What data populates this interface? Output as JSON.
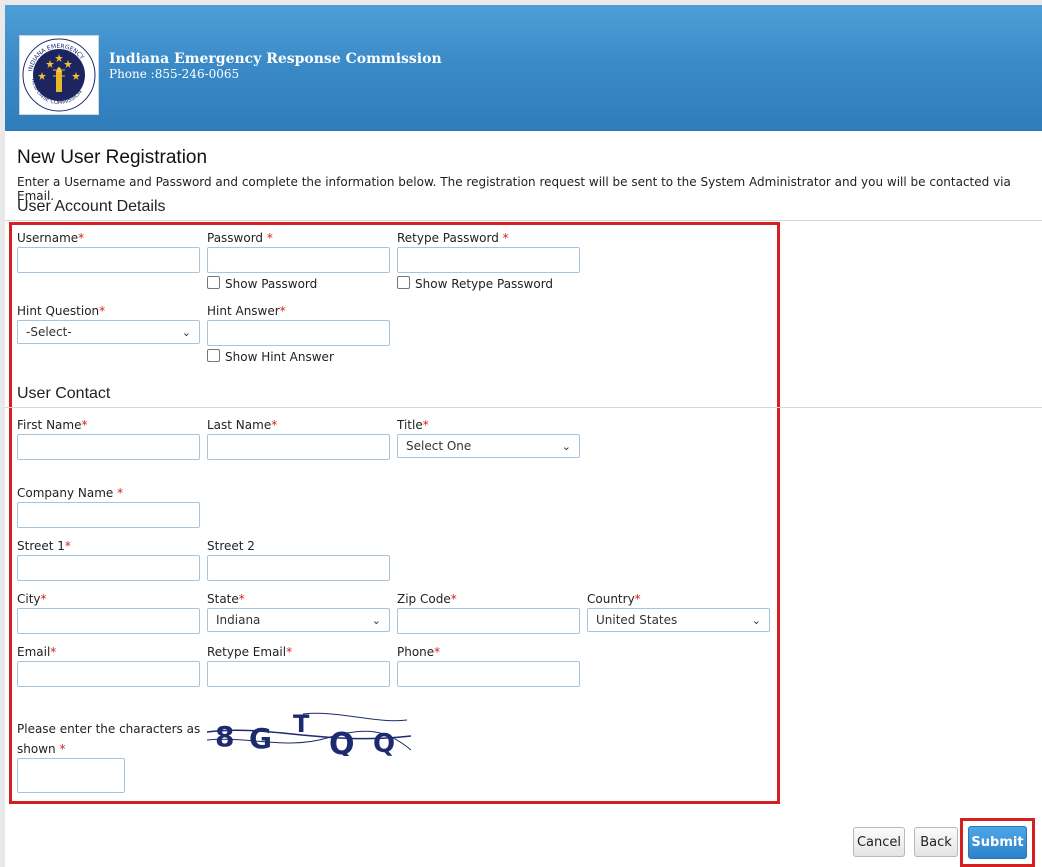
{
  "header": {
    "org_name": "Indiana Emergency Response Commission",
    "phone": "Phone :855-246-0065",
    "logo_text_top": "INDIANA EMERGENCY",
    "logo_text_bottom": "RESPONSE COMMISSION"
  },
  "page": {
    "title": "New User Registration",
    "instructions": "Enter a Username and Password and complete the information below. The registration request will be sent to the System Administrator and you will be contacted via Email."
  },
  "account": {
    "section_title": "User Account Details",
    "username_label": "Username",
    "password_label": "Password ",
    "retype_password_label": "Retype Password ",
    "show_password_label": "Show Password",
    "show_retype_password_label": "Show Retype Password",
    "hint_question_label": "Hint Question",
    "hint_question_value": "-Select-",
    "hint_answer_label": "Hint Answer",
    "show_hint_answer_label": "Show Hint Answer"
  },
  "contact": {
    "section_title": "User Contact",
    "first_name_label": "First Name",
    "last_name_label": "Last Name",
    "title_label": "Title",
    "title_value": "Select One",
    "company_label": "Company Name ",
    "street1_label": "Street 1",
    "street2_label": "Street 2",
    "city_label": "City",
    "state_label": "State",
    "state_value": "Indiana",
    "zip_label": "Zip Code",
    "country_label": "Country",
    "country_value": "United States",
    "email_label": "Email",
    "retype_email_label": "Retype Email",
    "phone_label": "Phone",
    "captcha_label_line1": "Please enter the characters as",
    "captcha_label_line2": "shown ",
    "captcha_text": "8 G T Q Q"
  },
  "required_marker": "*",
  "buttons": {
    "cancel": "Cancel",
    "back": "Back",
    "submit": "Submit"
  },
  "colors": {
    "header_blue": "#3b8bc8",
    "required_red": "#d42020",
    "highlight_red": "#d42020",
    "submit_blue": "#2b82cc",
    "captcha_navy": "#1c2a6e"
  }
}
